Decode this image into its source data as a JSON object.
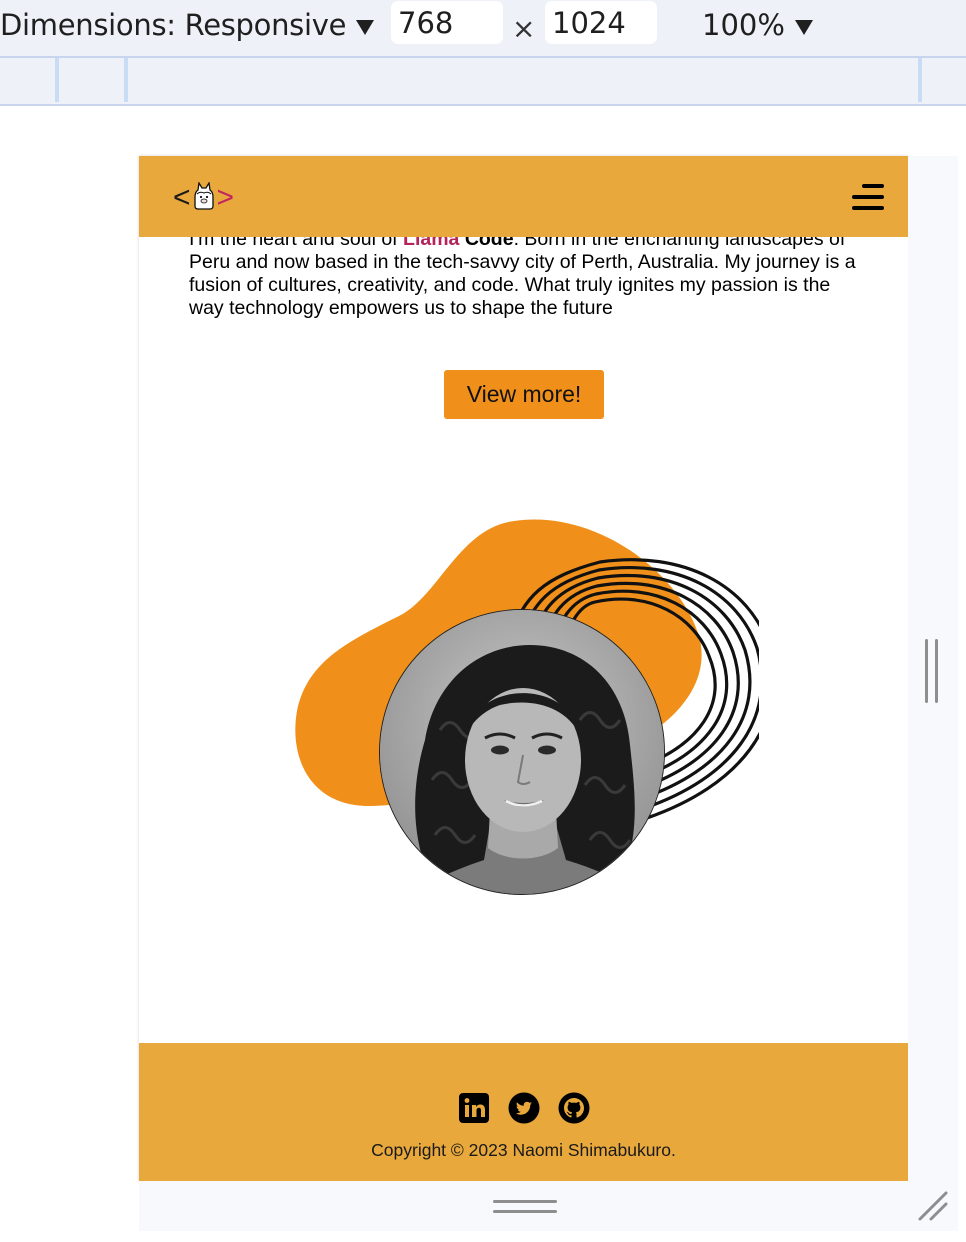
{
  "devtools": {
    "dimensions_label": "Dimensions: Responsive",
    "width_value": "768",
    "times_sign": "×",
    "height_value": "1024",
    "zoom_label": "100%"
  },
  "header": {
    "logo_left": "<",
    "logo_right": ">"
  },
  "about": {
    "line1_start": "I'm the heart and soul of",
    "brand_llama": "Llama",
    "brand_code": "Code",
    "line1_end": ". Born in the enchanting landscapes",
    "rest": "of Peru and now based in the tech-savvy city of Perth, Australia. My journey is a fusion of cultures, creativity, and code. What truly ignites my passion is the way technology empowers us to shape the future"
  },
  "cta": {
    "label": "View more!"
  },
  "footer": {
    "social_icons": [
      "linkedin-icon",
      "twitter-icon",
      "github-icon"
    ],
    "copyright": "Copyright © 2023 Naomi Shimabukuro."
  },
  "colors": {
    "header_bg": "#e8a83b",
    "button_bg": "#f0901a",
    "blob": "#f0901a",
    "brand_llama": "#b3245b",
    "logo_gt": "#c0265f"
  }
}
